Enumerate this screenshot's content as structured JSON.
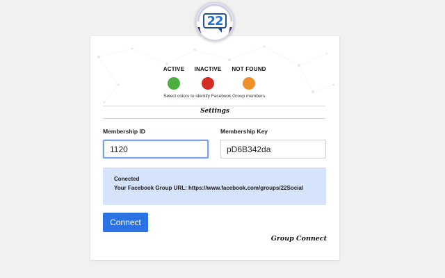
{
  "logo": {
    "text": "22",
    "icon": "speech-bubble-22-logo"
  },
  "legend": {
    "items": [
      {
        "label": "ACTIVE",
        "color": "#4caf3f"
      },
      {
        "label": "INACTIVE",
        "color": "#d42b22"
      },
      {
        "label": "NOT FOUND",
        "color": "#f0902a"
      }
    ],
    "hint": "Select colors to identify Facebook Group members."
  },
  "settings": {
    "title": "Settings"
  },
  "form": {
    "membership_id": {
      "label": "Membership ID",
      "value": "1120"
    },
    "membership_key": {
      "label": "Membership Key",
      "value": "pD6B342da"
    }
  },
  "status": {
    "line1": "Conected",
    "line2": "Your Facebook Group URL: https://www.facebook.com/groups/22Social"
  },
  "buttons": {
    "connect": "Connect"
  },
  "footer": {
    "brand": "Group Connect"
  },
  "colors": {
    "accent": "#2b73e4",
    "status_bg": "#d6e4fb",
    "focus_border": "#7f9ff0"
  }
}
